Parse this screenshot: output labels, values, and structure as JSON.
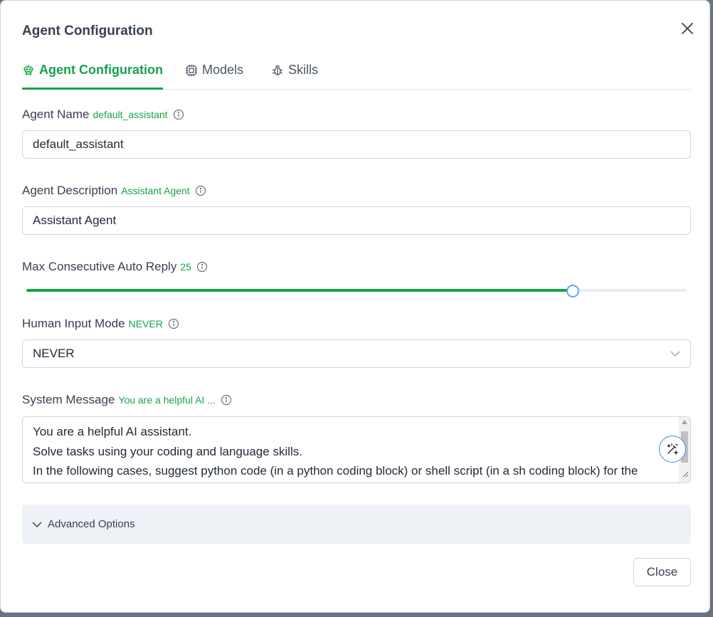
{
  "dialog": {
    "title": "Agent Configuration",
    "close_icon": "close-icon"
  },
  "tabs": [
    {
      "label": "Agent Configuration",
      "icon": "bot-icon",
      "active": true
    },
    {
      "label": "Models",
      "icon": "cpu-chip-icon",
      "active": false
    },
    {
      "label": "Skills",
      "icon": "bug-icon",
      "active": false
    }
  ],
  "fields": {
    "agent_name": {
      "label": "Agent Name",
      "badge": "default_assistant",
      "value": "default_assistant"
    },
    "agent_description": {
      "label": "Agent Description",
      "badge": "Assistant Agent",
      "value": "Assistant Agent"
    },
    "max_auto_reply": {
      "label": "Max Consecutive Auto Reply",
      "badge": "25",
      "fraction": 0.827
    },
    "human_input_mode": {
      "label": "Human Input Mode",
      "badge": "NEVER",
      "selected": "NEVER"
    },
    "system_message": {
      "label": "System Message",
      "badge": "You are a helpful AI ...",
      "lines": [
        "You are a helpful AI assistant.",
        "Solve tasks using your coding and language skills.",
        "In the following cases, suggest python code (in a python coding block) or shell script (in a sh coding block) for the"
      ]
    }
  },
  "advanced": {
    "label": "Advanced Options"
  },
  "footer": {
    "close_label": "Close"
  },
  "colors": {
    "accent": "#16a34a",
    "slider_handle": "#60a5fa",
    "advanced_bg": "#eef2f6"
  }
}
